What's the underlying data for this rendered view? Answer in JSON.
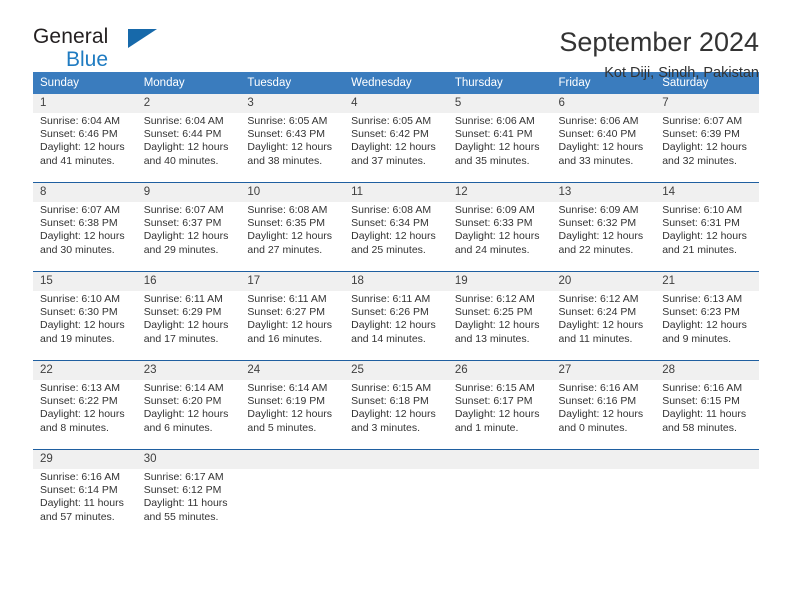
{
  "logo": {
    "line1": "General",
    "line2": "Blue",
    "triangle_color": "#1769aa",
    "blue_color": "#1f7bc1"
  },
  "header": {
    "title": "September 2024",
    "subtitle": "Kot Diji, Sindh, Pakistan"
  },
  "colors": {
    "header_row_bg": "#3a7cbe",
    "day_number_bg": "#f0f0f0",
    "week_separator": "#1f5fa0"
  },
  "calendar": {
    "day_headers": [
      "Sunday",
      "Monday",
      "Tuesday",
      "Wednesday",
      "Thursday",
      "Friday",
      "Saturday"
    ],
    "weeks": [
      [
        {
          "day": "1",
          "sunrise": "Sunrise: 6:04 AM",
          "sunset": "Sunset: 6:46 PM",
          "daylight1": "Daylight: 12 hours",
          "daylight2": "and 41 minutes."
        },
        {
          "day": "2",
          "sunrise": "Sunrise: 6:04 AM",
          "sunset": "Sunset: 6:44 PM",
          "daylight1": "Daylight: 12 hours",
          "daylight2": "and 40 minutes."
        },
        {
          "day": "3",
          "sunrise": "Sunrise: 6:05 AM",
          "sunset": "Sunset: 6:43 PM",
          "daylight1": "Daylight: 12 hours",
          "daylight2": "and 38 minutes."
        },
        {
          "day": "4",
          "sunrise": "Sunrise: 6:05 AM",
          "sunset": "Sunset: 6:42 PM",
          "daylight1": "Daylight: 12 hours",
          "daylight2": "and 37 minutes."
        },
        {
          "day": "5",
          "sunrise": "Sunrise: 6:06 AM",
          "sunset": "Sunset: 6:41 PM",
          "daylight1": "Daylight: 12 hours",
          "daylight2": "and 35 minutes."
        },
        {
          "day": "6",
          "sunrise": "Sunrise: 6:06 AM",
          "sunset": "Sunset: 6:40 PM",
          "daylight1": "Daylight: 12 hours",
          "daylight2": "and 33 minutes."
        },
        {
          "day": "7",
          "sunrise": "Sunrise: 6:07 AM",
          "sunset": "Sunset: 6:39 PM",
          "daylight1": "Daylight: 12 hours",
          "daylight2": "and 32 minutes."
        }
      ],
      [
        {
          "day": "8",
          "sunrise": "Sunrise: 6:07 AM",
          "sunset": "Sunset: 6:38 PM",
          "daylight1": "Daylight: 12 hours",
          "daylight2": "and 30 minutes."
        },
        {
          "day": "9",
          "sunrise": "Sunrise: 6:07 AM",
          "sunset": "Sunset: 6:37 PM",
          "daylight1": "Daylight: 12 hours",
          "daylight2": "and 29 minutes."
        },
        {
          "day": "10",
          "sunrise": "Sunrise: 6:08 AM",
          "sunset": "Sunset: 6:35 PM",
          "daylight1": "Daylight: 12 hours",
          "daylight2": "and 27 minutes."
        },
        {
          "day": "11",
          "sunrise": "Sunrise: 6:08 AM",
          "sunset": "Sunset: 6:34 PM",
          "daylight1": "Daylight: 12 hours",
          "daylight2": "and 25 minutes."
        },
        {
          "day": "12",
          "sunrise": "Sunrise: 6:09 AM",
          "sunset": "Sunset: 6:33 PM",
          "daylight1": "Daylight: 12 hours",
          "daylight2": "and 24 minutes."
        },
        {
          "day": "13",
          "sunrise": "Sunrise: 6:09 AM",
          "sunset": "Sunset: 6:32 PM",
          "daylight1": "Daylight: 12 hours",
          "daylight2": "and 22 minutes."
        },
        {
          "day": "14",
          "sunrise": "Sunrise: 6:10 AM",
          "sunset": "Sunset: 6:31 PM",
          "daylight1": "Daylight: 12 hours",
          "daylight2": "and 21 minutes."
        }
      ],
      [
        {
          "day": "15",
          "sunrise": "Sunrise: 6:10 AM",
          "sunset": "Sunset: 6:30 PM",
          "daylight1": "Daylight: 12 hours",
          "daylight2": "and 19 minutes."
        },
        {
          "day": "16",
          "sunrise": "Sunrise: 6:11 AM",
          "sunset": "Sunset: 6:29 PM",
          "daylight1": "Daylight: 12 hours",
          "daylight2": "and 17 minutes."
        },
        {
          "day": "17",
          "sunrise": "Sunrise: 6:11 AM",
          "sunset": "Sunset: 6:27 PM",
          "daylight1": "Daylight: 12 hours",
          "daylight2": "and 16 minutes."
        },
        {
          "day": "18",
          "sunrise": "Sunrise: 6:11 AM",
          "sunset": "Sunset: 6:26 PM",
          "daylight1": "Daylight: 12 hours",
          "daylight2": "and 14 minutes."
        },
        {
          "day": "19",
          "sunrise": "Sunrise: 6:12 AM",
          "sunset": "Sunset: 6:25 PM",
          "daylight1": "Daylight: 12 hours",
          "daylight2": "and 13 minutes."
        },
        {
          "day": "20",
          "sunrise": "Sunrise: 6:12 AM",
          "sunset": "Sunset: 6:24 PM",
          "daylight1": "Daylight: 12 hours",
          "daylight2": "and 11 minutes."
        },
        {
          "day": "21",
          "sunrise": "Sunrise: 6:13 AM",
          "sunset": "Sunset: 6:23 PM",
          "daylight1": "Daylight: 12 hours",
          "daylight2": "and 9 minutes."
        }
      ],
      [
        {
          "day": "22",
          "sunrise": "Sunrise: 6:13 AM",
          "sunset": "Sunset: 6:22 PM",
          "daylight1": "Daylight: 12 hours",
          "daylight2": "and 8 minutes."
        },
        {
          "day": "23",
          "sunrise": "Sunrise: 6:14 AM",
          "sunset": "Sunset: 6:20 PM",
          "daylight1": "Daylight: 12 hours",
          "daylight2": "and 6 minutes."
        },
        {
          "day": "24",
          "sunrise": "Sunrise: 6:14 AM",
          "sunset": "Sunset: 6:19 PM",
          "daylight1": "Daylight: 12 hours",
          "daylight2": "and 5 minutes."
        },
        {
          "day": "25",
          "sunrise": "Sunrise: 6:15 AM",
          "sunset": "Sunset: 6:18 PM",
          "daylight1": "Daylight: 12 hours",
          "daylight2": "and 3 minutes."
        },
        {
          "day": "26",
          "sunrise": "Sunrise: 6:15 AM",
          "sunset": "Sunset: 6:17 PM",
          "daylight1": "Daylight: 12 hours",
          "daylight2": "and 1 minute."
        },
        {
          "day": "27",
          "sunrise": "Sunrise: 6:16 AM",
          "sunset": "Sunset: 6:16 PM",
          "daylight1": "Daylight: 12 hours",
          "daylight2": "and 0 minutes."
        },
        {
          "day": "28",
          "sunrise": "Sunrise: 6:16 AM",
          "sunset": "Sunset: 6:15 PM",
          "daylight1": "Daylight: 11 hours",
          "daylight2": "and 58 minutes."
        }
      ],
      [
        {
          "day": "29",
          "sunrise": "Sunrise: 6:16 AM",
          "sunset": "Sunset: 6:14 PM",
          "daylight1": "Daylight: 11 hours",
          "daylight2": "and 57 minutes."
        },
        {
          "day": "30",
          "sunrise": "Sunrise: 6:17 AM",
          "sunset": "Sunset: 6:12 PM",
          "daylight1": "Daylight: 11 hours",
          "daylight2": "and 55 minutes."
        },
        {
          "day": "",
          "sunrise": "",
          "sunset": "",
          "daylight1": "",
          "daylight2": ""
        },
        {
          "day": "",
          "sunrise": "",
          "sunset": "",
          "daylight1": "",
          "daylight2": ""
        },
        {
          "day": "",
          "sunrise": "",
          "sunset": "",
          "daylight1": "",
          "daylight2": ""
        },
        {
          "day": "",
          "sunrise": "",
          "sunset": "",
          "daylight1": "",
          "daylight2": ""
        },
        {
          "day": "",
          "sunrise": "",
          "sunset": "",
          "daylight1": "",
          "daylight2": ""
        }
      ]
    ]
  }
}
